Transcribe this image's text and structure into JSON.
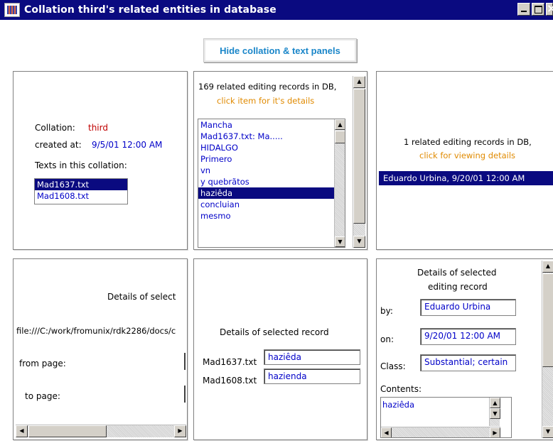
{
  "window": {
    "title": "Collation third's related entities in database",
    "hide_button": "Hide collation & text panels"
  },
  "collation_panel": {
    "collation_label": "Collation:",
    "collation_value": "third",
    "created_label": "created at:",
    "created_value": "9/5/01 12:00 AM",
    "texts_label": "Texts in this collation:",
    "texts": [
      "Mad1637.txt",
      "Mad1608.txt"
    ],
    "selected_text_index": 0
  },
  "records_panel": {
    "count_text": "169 related editing records in DB,",
    "hint_text": "click item for it's details",
    "items": [
      "Mancha",
      "Mad1637.txt: Ma.....",
      "HIDALGO",
      "Primero",
      "vn",
      "y quebrãtos",
      "haziêda",
      "concluian",
      "mesmo"
    ],
    "selected_index": 6
  },
  "editing_panel": {
    "count_text": "1 related editing records in DB,",
    "hint_text": "click for viewing details",
    "items": [
      "Eduardo Urbina, 9/20/01 12:00 AM"
    ],
    "selected_index": 0
  },
  "text_details_panel": {
    "title": "Details of select",
    "file_path": "file:///C:/work/fromunix/rdk2286/docs/c",
    "from_page_label": "from page:",
    "to_page_label": "to page:"
  },
  "record_details_panel": {
    "title": "Details of selected record",
    "rows": [
      {
        "label": "Mad1637.txt",
        "value": "haziêda"
      },
      {
        "label": "Mad1608.txt",
        "value": "hazienda"
      }
    ]
  },
  "editing_details_panel": {
    "title_line1": "Details of selected",
    "title_line2": "editing record",
    "by_label": "by:",
    "by_value": "Eduardo Urbina",
    "on_label": "on:",
    "on_value": "9/20/01 12:00 AM",
    "class_label": "Class:",
    "class_value": "Substantial; certain",
    "contents_label": "Contents:",
    "contents_value": "haziêda"
  },
  "colors": {
    "title_bar": "#0a0a80",
    "selection": "#0a0a80",
    "value_text": "#0000c8",
    "collation_name": "#c00000",
    "hint": "#e08a00",
    "button_text": "#1a86c9"
  }
}
